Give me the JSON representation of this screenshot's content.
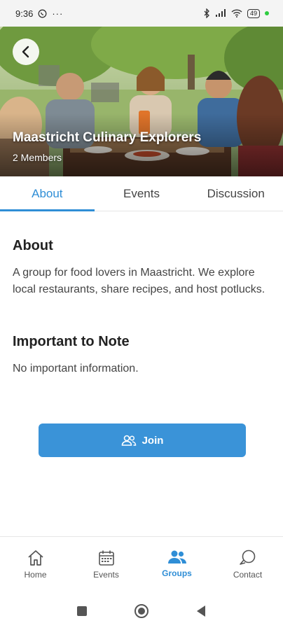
{
  "status_bar": {
    "time": "9:36",
    "more": "···",
    "battery": "49"
  },
  "group": {
    "title": "Maastricht Culinary Explorers",
    "members": "2 Members"
  },
  "tabs": [
    {
      "label": "About",
      "active": true
    },
    {
      "label": "Events",
      "active": false
    },
    {
      "label": "Discussion",
      "active": false
    }
  ],
  "about": {
    "heading": "About",
    "text": "A group for food lovers in Maastricht. We explore local restaurants, share recipes, and host potlucks."
  },
  "note": {
    "heading": "Important to Note",
    "text": "No important information."
  },
  "join_button": {
    "label": "Join",
    "icon": "users-icon"
  },
  "bottom_nav": [
    {
      "label": "Home",
      "icon": "home-icon",
      "active": false
    },
    {
      "label": "Events",
      "icon": "calendar-icon",
      "active": false
    },
    {
      "label": "Groups",
      "icon": "groups-icon",
      "active": true
    },
    {
      "label": "Contact",
      "icon": "chat-icon",
      "active": false
    }
  ],
  "colors": {
    "accent": "#2f8ed6",
    "button": "#3a93d8"
  }
}
